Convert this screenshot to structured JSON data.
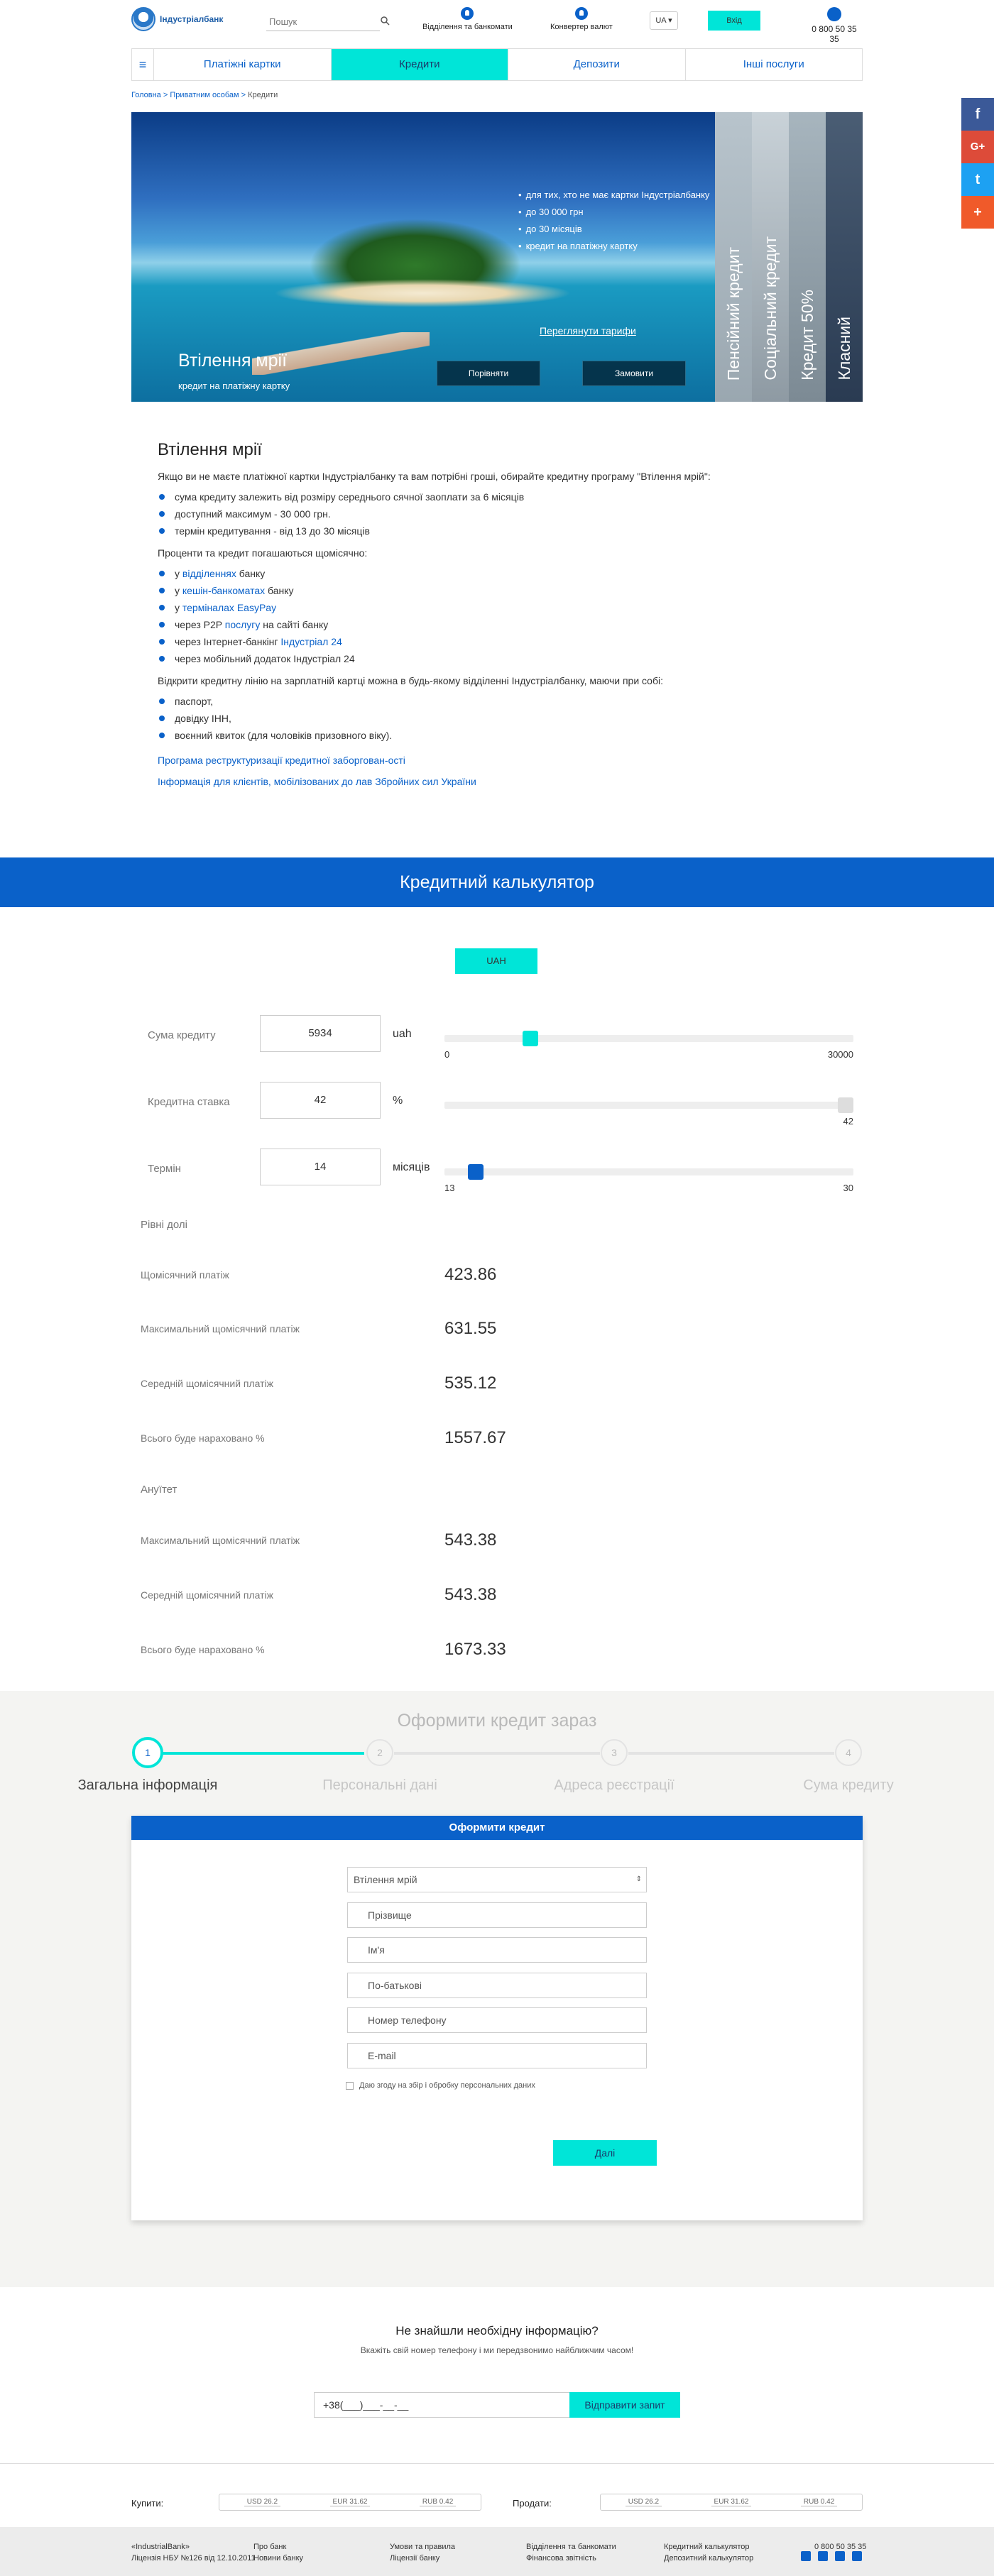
{
  "header": {
    "brand": "Індустріалбанк",
    "search_placeholder": "Пошук",
    "link_branches": "Відділення та банкомати",
    "link_converter": "Конвертер валют",
    "lang": "UA ▾",
    "login": "Вхід",
    "phone": "0 800 50 35 35"
  },
  "nav": {
    "items": [
      "Платіжні картки",
      "Кредити",
      "Депозити",
      "Інші послуги"
    ],
    "active_index": 1
  },
  "breadcrumb": {
    "items": [
      "Головна",
      "Приватним особам",
      "Кредити"
    ],
    "sep": ">"
  },
  "hero": {
    "bullets": [
      "для тих, хто не має картки Індустріалбанку",
      "до 30 000 грн",
      "до 30 місяців",
      "кредит на платіжну картку"
    ],
    "title": "Втілення мрії",
    "subtitle": "кредит на платіжну картку",
    "tariffs_link": "Переглянути тарифи",
    "btn_compare": "Порівняти",
    "btn_order": "Замовити",
    "tabs": [
      "Пенсійний кредит",
      "Соціальний кредит",
      "Кредит 50%",
      "Класний"
    ]
  },
  "article": {
    "title": "Втілення мрії",
    "intro": "Якщо ви не маєте платіжної картки Індустріалбанку та вам потрібні гроші, обирайте кредитну програму \"Втілення мрій\":",
    "terms": [
      "сума кредиту залежить від розміру середнього сячної заоплати за 6 місяців",
      "доступний максимум - 30 000 грн.",
      "термін кредитування - від 13 до 30 місяців"
    ],
    "payments_intro": "Проценти та кредит погашаються щомісячно:",
    "payments": [
      {
        "pre": "у ",
        "link": "відділеннях",
        "post": " банку"
      },
      {
        "pre": "у ",
        "link": "кешін-банкоматах",
        "post": " банку"
      },
      {
        "pre": "у ",
        "link": "терміналах EasyPay",
        "post": ""
      },
      {
        "pre": "через P2P ",
        "link": "послугу",
        "post": " на сайті банку"
      },
      {
        "pre": "через Інтернет-банкінг ",
        "link": "Індустріал 24",
        "post": ""
      },
      {
        "pre": "через мобільний додаток Індустріал 24",
        "link": "",
        "post": ""
      }
    ],
    "open_intro": "Відкрити кредитну лінію на зарплатній картці можна в будь-якому відділенні Індустріалбанку, маючи при собі:",
    "docs": [
      "паспорт,",
      "довідку ІНН,",
      "воєнний квиток (для чоловіків призовного віку)."
    ],
    "link1": "Програма реструктуризації кредитної заборгован-ості",
    "link2": "Інформація для клієнтів, мобілізованих до лав Збройних сил України"
  },
  "calculator": {
    "title": "Кредитний калькулятор",
    "currency_btn": "UAH",
    "amount": {
      "label": "Сума кредиту",
      "value": "5934",
      "unit": "uah",
      "min": "0",
      "max": "30000",
      "pos": 0.198
    },
    "rate": {
      "label": "Кредитна ставка",
      "value": "42",
      "unit": "%",
      "max": "42",
      "pos": 1.0
    },
    "term": {
      "label": "Термін",
      "value": "14",
      "unit": "місяців",
      "min": "13",
      "max": "30",
      "pos": 0.059
    },
    "equal_header": "Рівні долі",
    "equal": [
      {
        "label": "Щомісячний платіж",
        "value": "423.86"
      },
      {
        "label": "Максимальний щомісячний платіж",
        "value": "631.55"
      },
      {
        "label": "Середній щомісячний платіж",
        "value": "535.12"
      },
      {
        "label": "Всього буде нараховано %",
        "value": "1557.67"
      }
    ],
    "annuity_header": "Ануїтет",
    "annuity": [
      {
        "label": "Максимальний щомісячний платіж",
        "value": "543.38"
      },
      {
        "label": "Середній щомісячний платіж",
        "value": "543.38"
      },
      {
        "label": "Всього буде нараховано %",
        "value": "1673.33"
      }
    ]
  },
  "application": {
    "title": "Оформити кредит зараз",
    "steps": [
      {
        "num": "1",
        "label": "Загальна інформація"
      },
      {
        "num": "2",
        "label": "Персональні дані"
      },
      {
        "num": "3",
        "label": "Адреса реєстрації"
      },
      {
        "num": "4",
        "label": "Сума кредиту"
      }
    ],
    "card_title": "Оформити кредит",
    "select_value": "Втілення мрій",
    "fields": [
      "Прізвище",
      "Ім'я",
      "По-батькові",
      "Номер телефону",
      "E-mail"
    ],
    "agree": "Даю згоду на збір і обробку персональних даних",
    "next": "Далі"
  },
  "callback": {
    "title": "Не знайшли необхідну інформацію?",
    "subtitle": "Вкажіть свій номер телефону і ми передзвонимо найближчим часом!",
    "phone_mask": "+38(___)___-__-__",
    "button": "Відправити запит"
  },
  "rates": {
    "buy_label": "Купити:",
    "sell_label": "Продати:",
    "buy": [
      "USD 26.2",
      "EUR 31.62",
      "RUB 0.42"
    ],
    "sell": [
      "USD 26.2",
      "EUR 31.62",
      "RUB 0.42"
    ]
  },
  "footer": {
    "col1": [
      "«IndustrialBank»",
      "Ліцензія НБУ №126 від 12.10.2011"
    ],
    "col2": [
      "Про банк",
      "Новини банку"
    ],
    "col3": [
      "Умови та правила",
      "Ліцензії банку"
    ],
    "col4": [
      "Відділення та банкомати",
      "Фінансова звітність"
    ],
    "col5": [
      "Кредитний калькулятор",
      "Депозитний калькулятор"
    ],
    "phone": "0 800 50 35 35"
  },
  "social": [
    "f",
    "G+",
    "t",
    "+"
  ],
  "colors": {
    "accent": "#00e5d8",
    "primary": "#0a61c9"
  }
}
